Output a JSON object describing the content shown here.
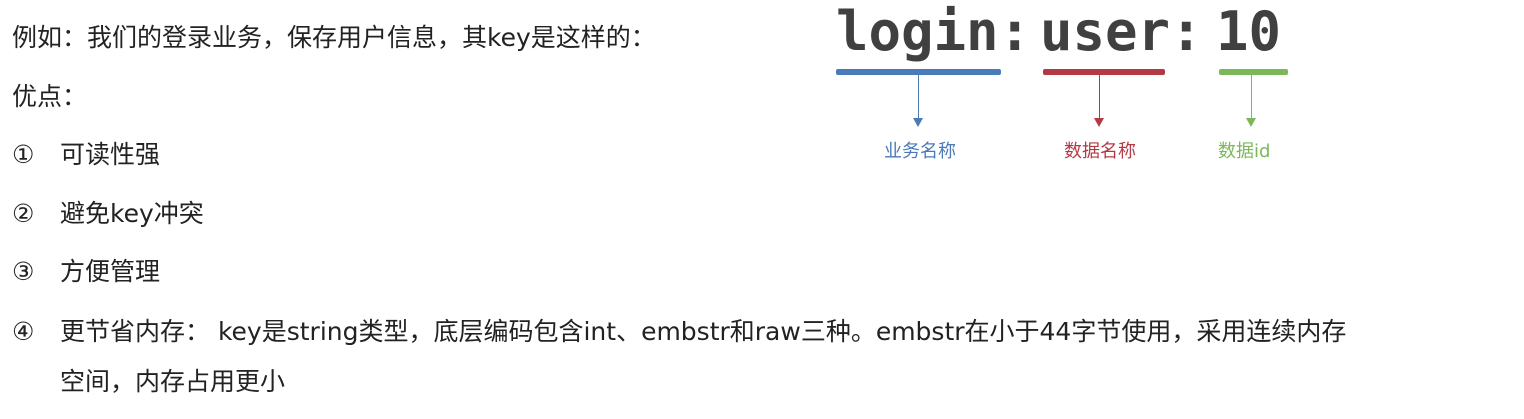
{
  "intro": "例如：我们的登录业务，保存用户信息，其key是这样的：",
  "pros_heading": "优点：",
  "items": [
    {
      "num": "①",
      "text": "可读性强"
    },
    {
      "num": "②",
      "text": "避免key冲突"
    },
    {
      "num": "③",
      "text": "方便管理"
    },
    {
      "num": "④",
      "text": "更节省内存： key是string类型，底层编码包含int、embstr和raw三种。embstr在小于44字节使用，采用连续内存",
      "cont": "空间，内存占用更小"
    }
  ],
  "diagram": {
    "parts": [
      {
        "text": "login:",
        "label": "业务名称",
        "color": "#4a7ab8"
      },
      {
        "text": "user:",
        "label": "数据名称",
        "color": "#b33a44"
      },
      {
        "text": "10",
        "label": "数据id",
        "color": "#7bb85a"
      }
    ]
  }
}
